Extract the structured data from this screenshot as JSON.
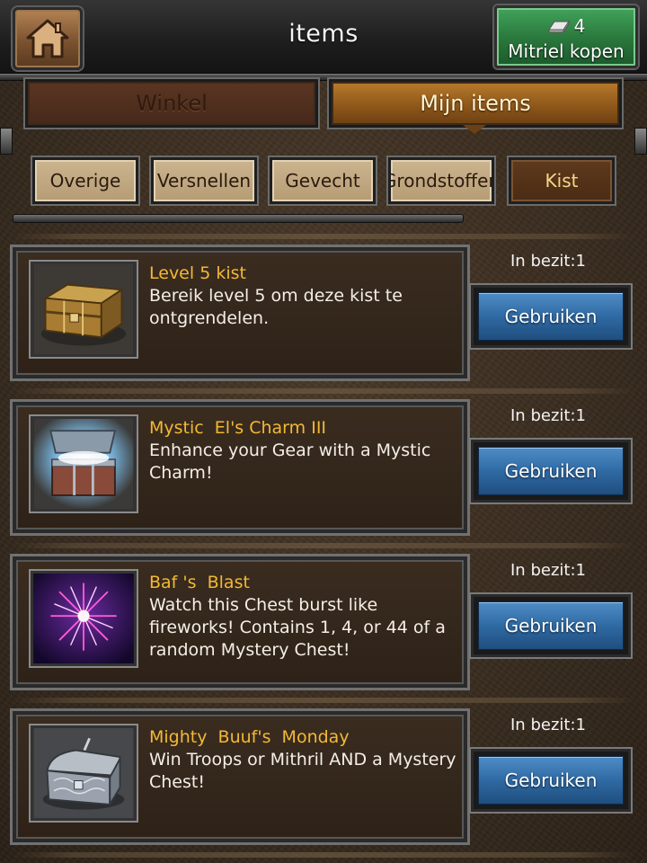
{
  "header": {
    "title": "items",
    "home_icon": "home-icon",
    "mithril": {
      "count": "4",
      "icon": "mithril-ingot-icon",
      "label": "Mitriel kopen"
    }
  },
  "main_tabs": [
    {
      "label": "Winkel",
      "active": false
    },
    {
      "label": "Mijn items",
      "active": true
    }
  ],
  "sub_tabs": [
    {
      "label": "Overige",
      "active": false
    },
    {
      "label": "Versnellen",
      "active": false
    },
    {
      "label": "Gevecht",
      "active": false
    },
    {
      "label": "Grondstoffen",
      "active": false
    },
    {
      "label": "Kist",
      "active": true
    }
  ],
  "items": [
    {
      "name": "Level 5 kist",
      "description": "Bereik level 5 om deze kist te ontgrendelen.",
      "owned": "In bezit:1",
      "button": "Gebruiken",
      "icon": "golden-chest-icon"
    },
    {
      "name": "Mystic  El's Charm III",
      "description": "Enhance your Gear with a Mystic Charm!",
      "owned": "In bezit:1",
      "button": "Gebruiken",
      "icon": "glowing-open-chest-icon"
    },
    {
      "name": "Baf 's  Blast",
      "description": "Watch this Chest burst like fireworks! Contains 1, 4, or 44 of a random Mystery Chest!",
      "owned": "In bezit:1",
      "button": "Gebruiken",
      "icon": "fireworks-icon"
    },
    {
      "name": "Mighty  Buuf's  Monday",
      "description": "Win Troops or Mithril AND a Mystery Chest!",
      "owned": "In bezit:1",
      "button": "Gebruiken",
      "icon": "silver-chest-icon"
    }
  ],
  "colors": {
    "item_name": "#f3b935",
    "use_button": "#2f6aa3",
    "active_main_tab": "#8b5519",
    "mithril_button": "#2b7a3e"
  }
}
